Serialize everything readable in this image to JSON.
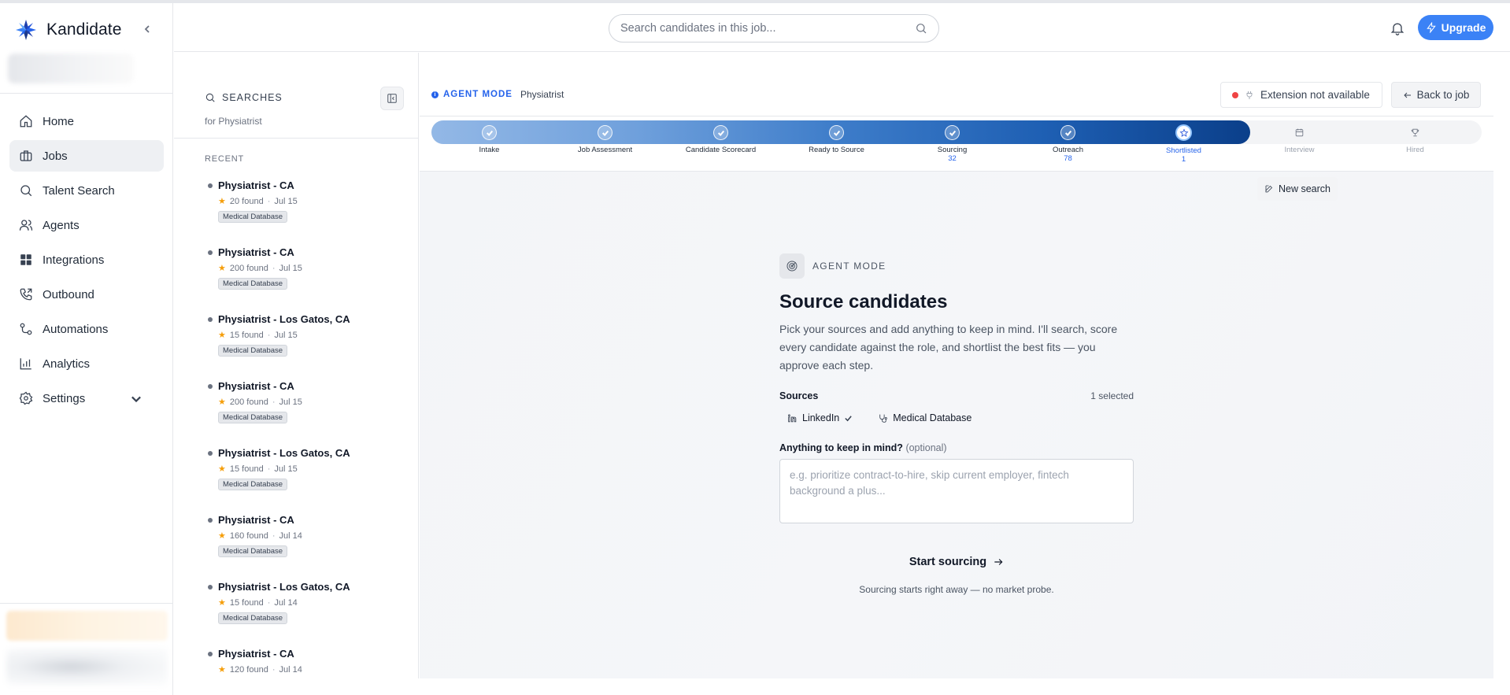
{
  "brand": {
    "name": "Kandidate"
  },
  "sidebar": {
    "items": [
      {
        "label": "Home",
        "icon": "home-icon",
        "active": false
      },
      {
        "label": "Jobs",
        "icon": "briefcase-icon",
        "active": true
      },
      {
        "label": "Talent Search",
        "icon": "search-icon",
        "active": false
      },
      {
        "label": "Agents",
        "icon": "users-icon",
        "active": false
      },
      {
        "label": "Integrations",
        "icon": "grid-icon",
        "active": false
      },
      {
        "label": "Outbound",
        "icon": "phone-icon",
        "active": false
      },
      {
        "label": "Automations",
        "icon": "workflow-icon",
        "active": false
      },
      {
        "label": "Analytics",
        "icon": "bar-chart-icon",
        "active": false
      },
      {
        "label": "Settings",
        "icon": "gear-icon",
        "active": false
      }
    ]
  },
  "topbar": {
    "search_placeholder": "Search candidates in this job...",
    "upgrade_label": "Upgrade"
  },
  "searches": {
    "title": "SEARCHES",
    "subtitle": "for Physiatrist",
    "recent_label": "RECENT",
    "items": [
      {
        "title": "Physiatrist - CA",
        "found": "20 found",
        "date": "Jul 15",
        "tag": "Medical Database"
      },
      {
        "title": "Physiatrist - CA",
        "found": "200 found",
        "date": "Jul 15",
        "tag": "Medical Database"
      },
      {
        "title": "Physiatrist - Los Gatos, CA",
        "found": "15 found",
        "date": "Jul 15",
        "tag": "Medical Database"
      },
      {
        "title": "Physiatrist - CA",
        "found": "200 found",
        "date": "Jul 15",
        "tag": "Medical Database"
      },
      {
        "title": "Physiatrist - Los Gatos, CA",
        "found": "15 found",
        "date": "Jul 15",
        "tag": "Medical Database"
      },
      {
        "title": "Physiatrist - CA",
        "found": "160 found",
        "date": "Jul 14",
        "tag": "Medical Database"
      },
      {
        "title": "Physiatrist - Los Gatos, CA",
        "found": "15 found",
        "date": "Jul 14",
        "tag": "Medical Database"
      },
      {
        "title": "Physiatrist - CA",
        "found": "120 found",
        "date": "Jul 14",
        "tag": ""
      }
    ]
  },
  "main": {
    "agent_label": "AGENT MODE",
    "job_name": "Physiatrist",
    "extension_label": "Extension not available",
    "back_label": "Back to job",
    "new_search_label": "New search"
  },
  "stepper": {
    "steps": [
      {
        "name": "Intake",
        "count": "",
        "state": "done"
      },
      {
        "name": "Job Assessment",
        "count": "",
        "state": "done"
      },
      {
        "name": "Candidate Scorecard",
        "count": "",
        "state": "done"
      },
      {
        "name": "Ready to Source",
        "count": "",
        "state": "done"
      },
      {
        "name": "Sourcing",
        "count": "32",
        "state": "done"
      },
      {
        "name": "Outreach",
        "count": "78",
        "state": "done"
      },
      {
        "name": "Shortlisted",
        "count": "1",
        "state": "current"
      },
      {
        "name": "Interview",
        "count": "",
        "state": "future"
      },
      {
        "name": "Hired",
        "count": "",
        "state": "future"
      }
    ]
  },
  "card": {
    "mode_label": "AGENT MODE",
    "title": "Source candidates",
    "description": "Pick your sources and add anything to keep in mind. I'll search, score every candidate against the role, and shortlist the best fits — you approve each step.",
    "sources_label": "Sources",
    "sources_count": "1 selected",
    "sources": [
      {
        "label": "LinkedIn",
        "selected": true
      },
      {
        "label": "Medical Database",
        "selected": false
      }
    ],
    "note_label": "Anything to keep in mind?",
    "note_optional": "(optional)",
    "note_placeholder": "e.g. prioritize contract-to-hire, skip current employer, fintech background a plus...",
    "start_label": "Start sourcing",
    "start_note": "Sourcing starts right away — no market probe."
  },
  "colors": {
    "accent": "#3b82f6",
    "accent_dark": "#0b3f8a",
    "status_red": "#ef4444",
    "star": "#f59e0b"
  }
}
